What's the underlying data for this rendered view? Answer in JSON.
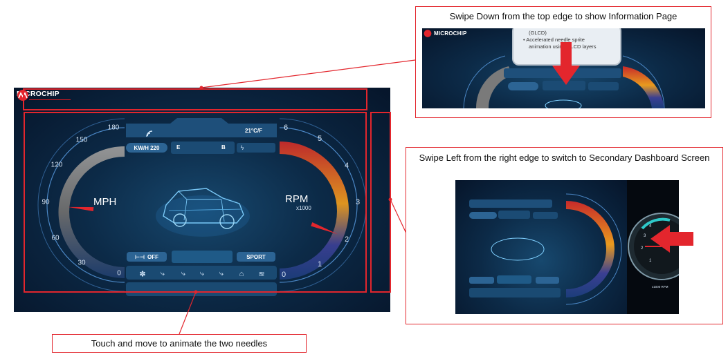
{
  "brand": {
    "logo_text": "MICROCHIP"
  },
  "speedometer": {
    "ticks": [
      "180",
      "150",
      "120",
      "90",
      "60",
      "30",
      "0"
    ],
    "unit": "MPH",
    "needle_value": 95,
    "max": 180
  },
  "tachometer": {
    "ticks": [
      "6",
      "5",
      "4",
      "3",
      "2",
      "1",
      "0"
    ],
    "unit": "RPM",
    "unit_sub": "x1000",
    "needle_value": 2.3,
    "max": 6
  },
  "status": {
    "temperature": "21°C/F",
    "kwh": "KW/H 220",
    "fuel_empty": "E",
    "fuel_full": "B",
    "bolt_icon": "lightning-icon",
    "wifi_icon": "wifi-icon"
  },
  "controls": {
    "off_label": "OFF",
    "sport_label": "SPORT",
    "icons": [
      "fan-icon",
      "seat-heat-icon",
      "seat-heat-2-icon",
      "seat-heat-3-icon",
      "seat-icon",
      "car-defrost-icon",
      "windshield-defrost-icon"
    ]
  },
  "callouts": {
    "info_title": "Swipe Down from the top edge to show Information Page",
    "info_popup_lines": [
      "(GLCD)",
      "Accelerated needle sprite",
      "animation using GLCD layers"
    ],
    "secondary_title": "Swipe Left from the right edge to switch to Secondary Dashboard Screen",
    "gauge_label": "x1000 RPM",
    "touch_note": "Touch and move to animate the two needles"
  },
  "colors": {
    "accent_red": "#e3262d",
    "gauge_blue": "#2c6494"
  }
}
